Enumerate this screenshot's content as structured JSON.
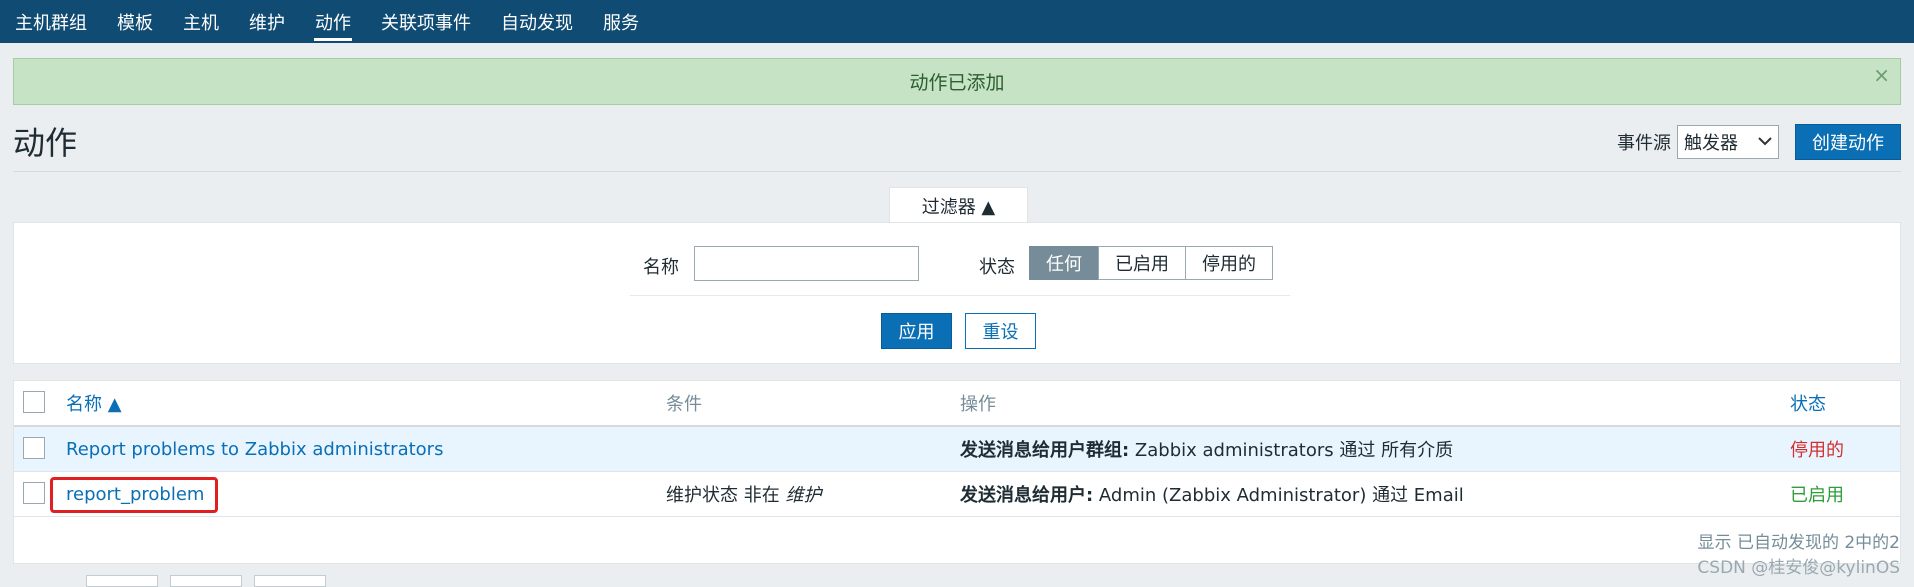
{
  "nav": {
    "items": [
      {
        "label": "主机群组"
      },
      {
        "label": "模板"
      },
      {
        "label": "主机"
      },
      {
        "label": "维护"
      },
      {
        "label": "动作",
        "active": true
      },
      {
        "label": "关联项事件"
      },
      {
        "label": "自动发现"
      },
      {
        "label": "服务"
      }
    ]
  },
  "notice": {
    "message": "动作已添加",
    "close": "×"
  },
  "page": {
    "title": "动作",
    "event_source_label": "事件源",
    "event_source_value": "触发器",
    "create_button": "创建动作"
  },
  "filter": {
    "tab_label": "过滤器 ▲",
    "name_label": "名称",
    "name_value": "",
    "status_label": "状态",
    "status_options": [
      "任何",
      "已启用",
      "停用的"
    ],
    "status_selected": "任何",
    "apply": "应用",
    "reset": "重设"
  },
  "table": {
    "headers": {
      "name": "名称 ▲",
      "conditions": "条件",
      "operations": "操作",
      "status": "状态"
    },
    "rows": [
      {
        "name": "Report problems to Zabbix administrators",
        "conditions": "",
        "op_bold": "发送消息给用户群组:",
        "op_text": " Zabbix administrators 通过 所有介质",
        "status": "停用的"
      },
      {
        "name": "report_problem",
        "conditions_text": "维护状态 非在 ",
        "conditions_em": "维护",
        "op_bold": "发送消息给用户:",
        "op_text": " Admin (Zabbix Administrator) 通过 Email",
        "status": "已启用"
      }
    ]
  },
  "footer": {
    "count": "显示 已自动发现的 2中的2",
    "watermark": "CSDN @桂安俊@kylinOS"
  },
  "colors": {
    "nav_bg": "#0f4b73",
    "accent": "#0a6fb5",
    "success_bg": "#c6e3c6",
    "status_disabled": "#d32f2f",
    "status_enabled": "#2e9e3a",
    "highlight": "#e02020"
  }
}
